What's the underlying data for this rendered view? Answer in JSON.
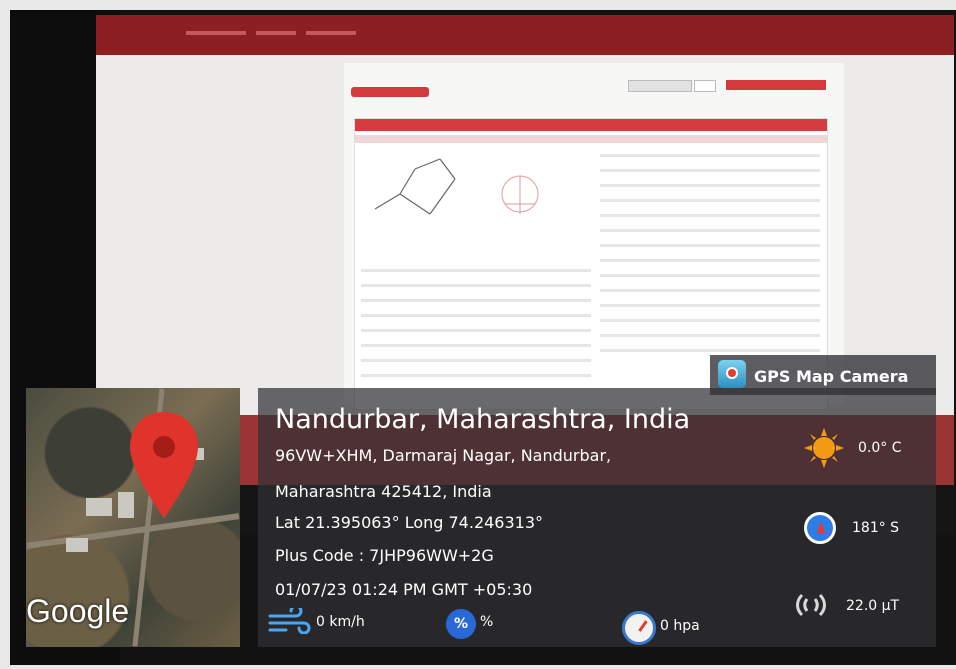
{
  "badge": {
    "app_name": "GPS Map Camera"
  },
  "location": {
    "title": "Nandurbar, Maharashtra, India",
    "address_line1": "96VW+XHM, Darmaraj Nagar, Nandurbar,",
    "address_line2": "Maharashtra 425412, India",
    "coords": "Lat 21.395063° Long 74.246313°",
    "plus_code": "Plus Code : 7JHP96WW+2G",
    "datetime": "01/07/23 01:24 PM GMT +05:30"
  },
  "map": {
    "brand": "Google"
  },
  "metrics": {
    "temperature": "0.0° C",
    "heading": "181° S",
    "magnetic": "22.0 µT",
    "wind": "0 km/h",
    "humidity_symbol": "%",
    "humidity": "%",
    "pressure": "0 hpa"
  },
  "icons": {
    "temperature": "sun-icon",
    "heading": "compass-icon",
    "magnetic": "magnet-icon",
    "wind": "wind-icon",
    "humidity": "humidity-icon",
    "pressure": "gauge-icon",
    "location": "map-pin-icon",
    "app": "gps-map-camera-icon"
  },
  "colors": {
    "pin": "#e0332c",
    "accent": "#d53c3f",
    "overlay": "#303034"
  }
}
